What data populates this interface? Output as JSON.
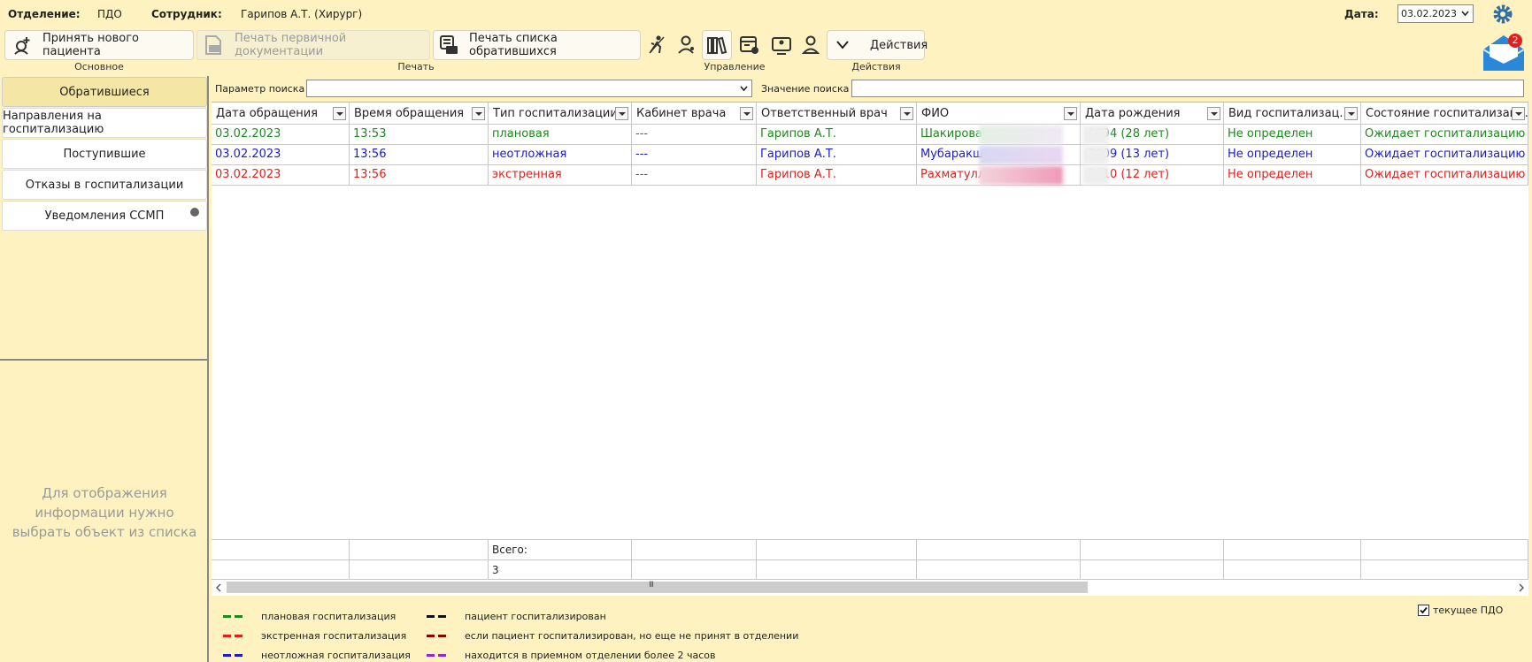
{
  "header": {
    "dept_label": "Отделение:",
    "dept_value": "ПДО",
    "employee_label": "Сотрудник:",
    "employee_value": "Гарипов А.Т. (Хирург)",
    "date_label": "Дата:",
    "date_value": "03.02.2023",
    "mail_badge": "2"
  },
  "toolbar": {
    "new_patient": "Принять нового пациента",
    "print_primary": "Печать первичной документации",
    "print_list": "Печать списка обратившихся",
    "actions": "Действия",
    "groups": {
      "basic": "Основное",
      "print": "Печать",
      "manage": "Управление",
      "actions": "Действия"
    }
  },
  "nav": {
    "items": [
      "Обратившиеся",
      "Направления на госпитализацию",
      "Поступившие",
      "Отказы в госпитализации",
      "Уведомления ССМП"
    ],
    "empty_message": "Для отображения информации нужно выбрать объект из списка"
  },
  "search": {
    "param_label": "Параметр поиска",
    "value_label": "Значение поиска"
  },
  "table": {
    "columns": [
      "Дата обращения",
      "Время обращения",
      "Тип госпитализации",
      "Кабинет врача",
      "Ответственный врач",
      "ФИО",
      "Дата рождения",
      "Вид госпитализац...",
      "Состояние госпитализац..."
    ],
    "rows": [
      {
        "color": "#1d8a1d",
        "cells": [
          "03.02.2023",
          "13:53",
          "плановая",
          "---",
          "Гарипов А.Т.",
          "Шакирова",
          ".1994 (28 лет)",
          "Не определен",
          "Ожидает госпитализацию"
        ]
      },
      {
        "color": "#1a1ad0",
        "cells": [
          "03.02.2023",
          "13:56",
          "неотложная",
          "---",
          "Гарипов А.Т.",
          "Мубаракши",
          ".2009 (13 лет)",
          "Не определен",
          "Ожидает госпитализацию"
        ]
      },
      {
        "color": "#e0201a",
        "cells": [
          "03.02.2023",
          "13:56",
          "экстренная",
          "---",
          "Гарипов А.Т.",
          "Рахматулли",
          ".2010 (12 лет)",
          "Не определен",
          "Ожидает госпитализацию"
        ]
      }
    ],
    "footer_total_label": "Всего:",
    "footer_total_value": "3",
    "scroll_grip": "III"
  },
  "legend": {
    "items": [
      {
        "color": "#1d8a1d",
        "label": "плановая госпитализация"
      },
      {
        "color": "#e0201a",
        "label": "экстренная госпитализация"
      },
      {
        "color": "#1a1ad0",
        "label": "неотложная госпитализация"
      },
      {
        "color": "#111111",
        "label": "пациент госпитализирован"
      },
      {
        "color": "#8b0000",
        "label": "если пациент госпитализирован, но еще не принят в  отделении"
      },
      {
        "color": "#8a2be2",
        "label": "находится в приемном отделении более 2 часов"
      }
    ],
    "current_pdo": "текущее ПДО",
    "current_pdo_checked": true
  }
}
